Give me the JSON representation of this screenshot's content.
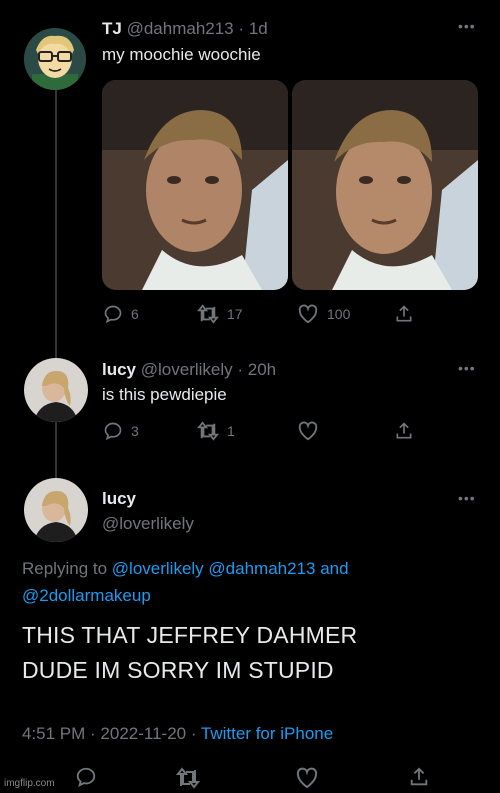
{
  "tweet1": {
    "name": "TJ",
    "handle": "@dahmah213",
    "time": "· 1d",
    "text": "my moochie woochie",
    "replies": "6",
    "retweets": "17",
    "likes": "100"
  },
  "tweet2": {
    "name": "lucy",
    "handle": "@loverlikely",
    "time": "· 20h",
    "text": "is this pewdiepie",
    "replies": "3",
    "retweets": "1"
  },
  "tweet3": {
    "name": "lucy",
    "handle": "@loverlikely",
    "replying_prefix": "Replying to",
    "mention1": "@loverlikely",
    "mention2": "@dahmah213",
    "and_word": "and",
    "mention3": "@2dollarmakeup",
    "text_line1": "THIS THAT JEFFREY DAHMER",
    "text_line2": "DUDE IM SORRY IM STUPID",
    "timestamp": "4:51 PM · 2022-11-20 ·",
    "source": "Twitter for iPhone"
  },
  "watermark": "imgflip.com",
  "colors": {
    "background": "#000000",
    "text": "#e7e9ea",
    "muted": "#71767b",
    "link": "#1d9bf0"
  }
}
